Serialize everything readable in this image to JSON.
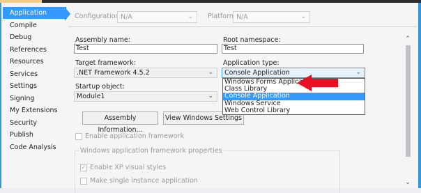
{
  "colors": {
    "accent": "#3399ff",
    "window_border": "#3399dd",
    "arrow": "#e81123"
  },
  "sidebar": {
    "items": [
      {
        "label": "Application"
      },
      {
        "label": "Compile"
      },
      {
        "label": "Debug"
      },
      {
        "label": "References"
      },
      {
        "label": "Resources"
      },
      {
        "label": "Services"
      },
      {
        "label": "Settings"
      },
      {
        "label": "Signing"
      },
      {
        "label": "My Extensions"
      },
      {
        "label": "Security"
      },
      {
        "label": "Publish"
      },
      {
        "label": "Code Analysis"
      }
    ],
    "selected": "Application"
  },
  "config_bar": {
    "configuration_label": "Configuration:",
    "configuration_value": "N/A",
    "platform_label": "Platform:",
    "platform_value": "N/A"
  },
  "form": {
    "assembly_name_label": "Assembly name:",
    "assembly_name_value": "Test",
    "root_namespace_label": "Root namespace:",
    "root_namespace_value": "Test",
    "target_framework_label": "Target framework:",
    "target_framework_value": ".NET Framework 4.5.2",
    "application_type_label": "Application type:",
    "application_type_value": "Console Application",
    "startup_object_label": "Startup object:",
    "startup_object_value": "Module1",
    "assembly_info_button": "Assembly Information...",
    "view_settings_button": "View Windows Settings",
    "enable_framework_label": "Enable application framework",
    "group_label": "Windows application framework properties",
    "enable_xp_label": "Enable XP visual styles",
    "single_instance_label": "Make single instance application"
  },
  "dropdown": {
    "options": [
      {
        "label": "Windows Forms Application"
      },
      {
        "label": "Class Library"
      },
      {
        "label": "Console Application"
      },
      {
        "label": "Windows Service"
      },
      {
        "label": "Web Control Library"
      }
    ],
    "highlighted": "Console Application"
  },
  "icons": {
    "chevron": "⌄",
    "scroll_up": "⌃",
    "scroll_down": "⌄",
    "check": "✓"
  }
}
